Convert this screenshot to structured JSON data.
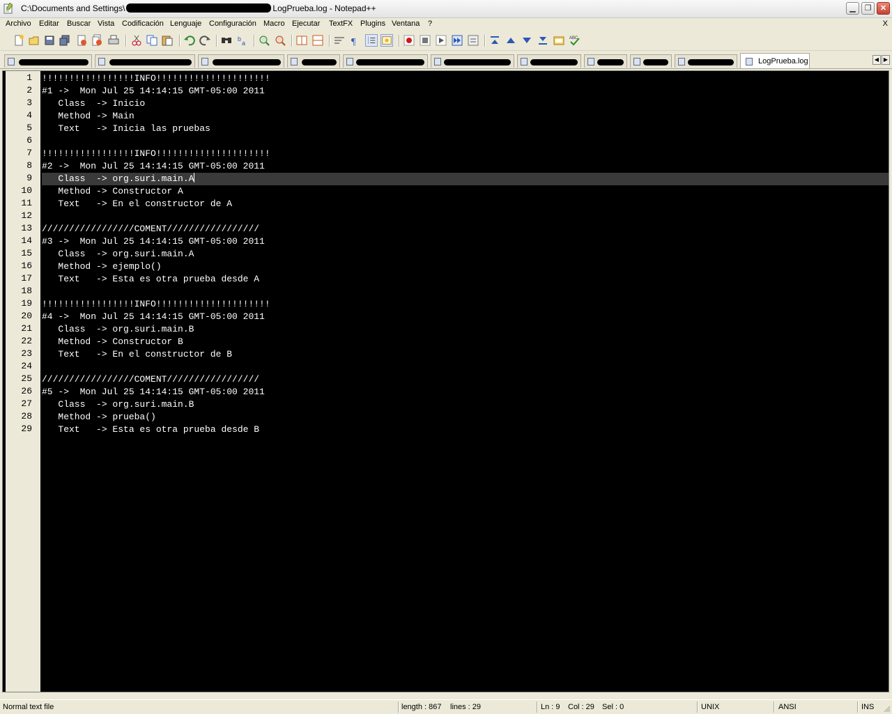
{
  "window": {
    "title_prefix": "C:\\Documents and Settings\\",
    "title_suffix": "LogPrueba.log - Notepad++",
    "buttons": {
      "minimize": "▁",
      "restore": "❐",
      "close": "✕"
    }
  },
  "menu": {
    "items": [
      "Archivo",
      "Editar",
      "Buscar",
      "Vista",
      "Codificación",
      "Lenguaje",
      "Configuración",
      "Macro",
      "Ejecutar",
      "TextFX",
      "Plugins",
      "Ventana",
      "?"
    ],
    "close": "X"
  },
  "toolbar": {
    "icons": [
      "new-icon",
      "open-icon",
      "save-icon",
      "save-all-icon",
      "close-icon",
      "close-all-icon",
      "print-icon",
      "cut-icon",
      "copy-icon",
      "paste-icon",
      "undo-icon",
      "redo-icon",
      "find-icon",
      "replace-icon",
      "zoom-in-icon",
      "zoom-out-icon",
      "sync-v-icon",
      "sync-h-icon",
      "word-wrap-icon",
      "show-all-chars-icon",
      "indent-guide-icon",
      "user-lang-icon",
      "record-macro-icon",
      "stop-macro-icon",
      "play-macro-icon",
      "run-macro-multiple-icon",
      "save-macro-icon",
      "fold-icon",
      "prev-icon",
      "next-icon",
      "unfold-icon",
      "panel-icon",
      "spellcheck-icon"
    ]
  },
  "tabs": {
    "active_label": "LogPrueba.log"
  },
  "editor": {
    "current_line": 9,
    "lines": [
      "!!!!!!!!!!!!!!!!!INFO!!!!!!!!!!!!!!!!!!!!!",
      "#1 ->  Mon Jul 25 14:14:15 GMT-05:00 2011",
      "   Class  -> Inicio",
      "   Method -> Main",
      "   Text   -> Inicia las pruebas",
      "",
      "!!!!!!!!!!!!!!!!!INFO!!!!!!!!!!!!!!!!!!!!!",
      "#2 ->  Mon Jul 25 14:14:15 GMT-05:00 2011",
      "   Class  -> org.suri.main.A",
      "   Method -> Constructor A",
      "   Text   -> En el constructor de A",
      "",
      "/////////////////COMENT/////////////////",
      "#3 ->  Mon Jul 25 14:14:15 GMT-05:00 2011",
      "   Class  -> org.suri.main.A",
      "   Method -> ejemplo()",
      "   Text   -> Esta es otra prueba desde A",
      "",
      "!!!!!!!!!!!!!!!!!INFO!!!!!!!!!!!!!!!!!!!!!",
      "#4 ->  Mon Jul 25 14:14:15 GMT-05:00 2011",
      "   Class  -> org.suri.main.B",
      "   Method -> Constructor B",
      "   Text   -> En el constructor de B",
      "",
      "/////////////////COMENT/////////////////",
      "#5 ->  Mon Jul 25 14:14:15 GMT-05:00 2011",
      "   Class  -> org.suri.main.B",
      "   Method -> prueba()",
      "   Text   -> Esta es otra prueba desde B"
    ]
  },
  "status": {
    "file_type": "Normal text file",
    "length": "length : 867",
    "lines": "lines : 29",
    "ln": "Ln : 9",
    "col": "Col : 29",
    "sel": "Sel : 0",
    "eol": "UNIX",
    "encoding": "ANSI",
    "mode": "INS"
  },
  "colors": {
    "editor_bg": "#000000",
    "editor_fg": "#ffffff",
    "current_line_bg": "#3a3a3a",
    "chrome_bg": "#ece9d8"
  }
}
